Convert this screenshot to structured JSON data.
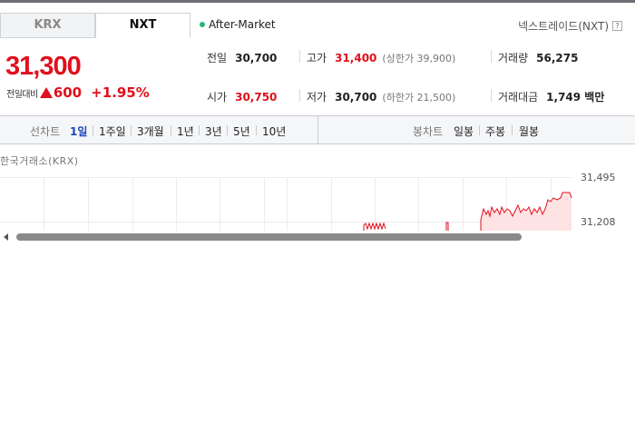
{
  "tabs": [
    {
      "label": "KRX",
      "active": false
    },
    {
      "label": "NXT",
      "active": true
    }
  ],
  "session": {
    "label": "After-Market",
    "dot_color": "#2bb673"
  },
  "nxt_link": {
    "label": "넥스트레이드(NXT)",
    "help": "?"
  },
  "price": {
    "current": "31,300",
    "change_label": "전일대비",
    "change_direction": "up",
    "change_amount": "600",
    "change_pct": "+1.95%"
  },
  "stats": {
    "prev_close": {
      "label": "전일",
      "value": "30,700"
    },
    "high": {
      "label": "고가",
      "value": "31,400",
      "sub": "(상한가 39,900)"
    },
    "volume": {
      "label": "거래량",
      "value": "56,275"
    },
    "open": {
      "label": "시가",
      "value": "30,750"
    },
    "low": {
      "label": "저가",
      "value": "30,700",
      "sub": "(하한가 21,500)"
    },
    "turnover": {
      "label": "거래대금",
      "value": "1,749 백만"
    }
  },
  "line_chart": {
    "label": "선차트",
    "periods": [
      "1일",
      "1주일",
      "3개월",
      "1년",
      "3년",
      "5년",
      "10년"
    ],
    "selected": "1일"
  },
  "candle_chart": {
    "label": "봉차트",
    "periods": [
      "일봉",
      "주봉",
      "월봉"
    ]
  },
  "chart": {
    "source": "한국거래소(KRX)",
    "y_labels": [
      "31,495",
      "31,208"
    ],
    "line_color": "#e0101c",
    "fill_color": "#fde3e3"
  }
}
